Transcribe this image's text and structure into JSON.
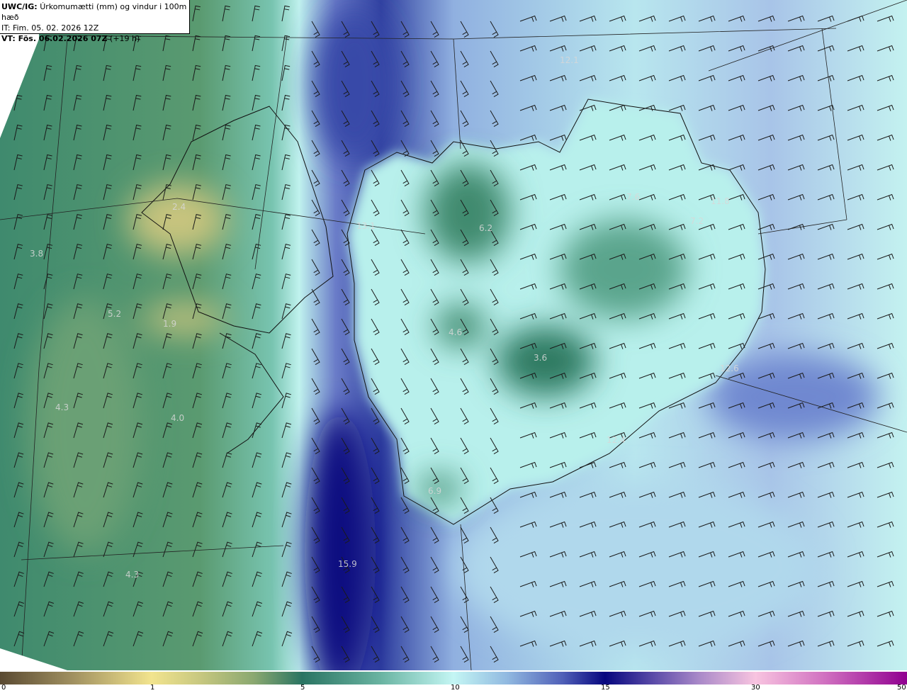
{
  "title": {
    "model_label": "UWC/IG:",
    "description": "Úrkomumætti (mm) og vindur i 100m hæð",
    "init_time": "IT: Fim. 05. 02. 2026 12Z",
    "valid_label": "VT: Fös. 06.02.2026 07Z",
    "lead_time": "(+19 h)"
  },
  "map_values": [
    "12.1",
    "2.4",
    "3.8",
    "5.2",
    "1.9",
    "4.3",
    "4.0",
    "4.3",
    "15.9",
    "13.1",
    "6.2",
    "4.6",
    "3.6",
    "6.9",
    "7.6",
    "11.8",
    "7.2",
    "12.6",
    "12.4"
  ],
  "colorbar": {
    "ticks": [
      "0",
      "1",
      "5",
      "10",
      "15",
      "30",
      "50"
    ],
    "colors": [
      "#5a4a32",
      "#f2e48e",
      "#2a7462",
      "#c4f6f4",
      "#06067e",
      "#f8c4e0",
      "#900090"
    ]
  }
}
